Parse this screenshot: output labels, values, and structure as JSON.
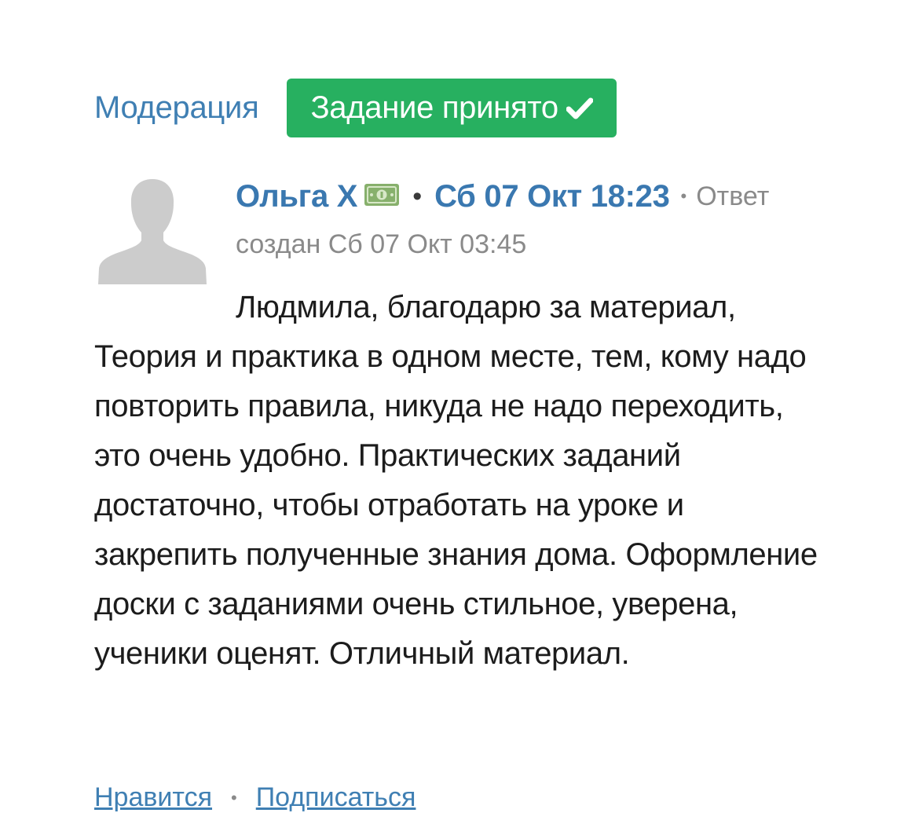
{
  "header": {
    "moderation_label": "Модерация",
    "status_badge_label": "Задание принято",
    "status_color": "#27b060"
  },
  "comment": {
    "avatar_icon": "user-silhouette-icon",
    "author_name": "Ольга Х",
    "author_badge_icon": "money-bill-icon",
    "timestamp": "Сб 07 Окт 18:23",
    "reply_label": "Ответ",
    "created_label": "создан Сб 07 Окт 03:45",
    "text": "Людмила, благодарю за материал, Теория и практика в одном месте, тем, кому надо повторить правила, никуда не надо переходить, это очень удобно. Практических заданий достаточно, чтобы отработать на уроке и закрепить полученные знания дома. Оформление доски с заданиями очень стильное, уверена, ученики оценят. Отличный материал."
  },
  "footer": {
    "like_label": "Нравится",
    "subscribe_label": "Подписаться"
  },
  "colors": {
    "link": "#3f7fb3",
    "author_link": "#3a78b0",
    "meta_text": "#8a8a8a",
    "body_text": "#1c1c1c"
  }
}
